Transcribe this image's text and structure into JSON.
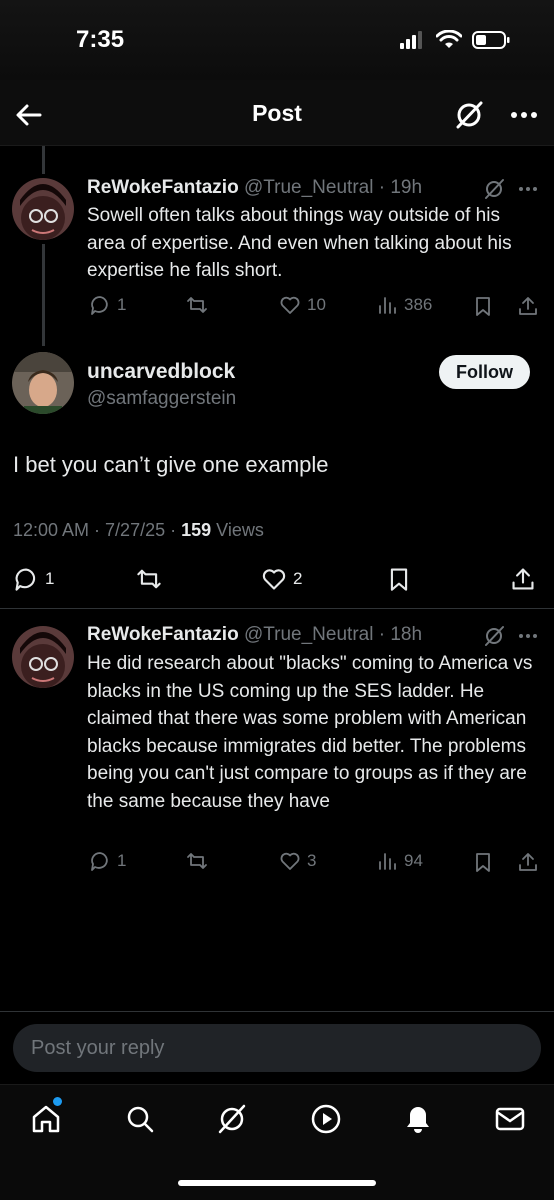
{
  "status": {
    "time": "7:35"
  },
  "header": {
    "title": "Post"
  },
  "reply1": {
    "name": "ReWokeFantazio",
    "handle_time": "@True_Neutral · 19h",
    "text": "Sowell often talks about things way outside of his area of expertise. And even when talking about his expertise he falls short.",
    "replies": "1",
    "likes": "10",
    "views": "386"
  },
  "main": {
    "name": "uncarvedblock",
    "handle": "@samfaggerstein",
    "follow_label": "Follow",
    "text": "I bet you can’t give one example",
    "timestamp": "12:00 AM · 7/27/25 · ",
    "views_count": "159",
    "views_label": " Views",
    "replies": "1",
    "likes": "2"
  },
  "reply2": {
    "name": "ReWokeFantazio",
    "handle_time": "@True_Neutral · 18h",
    "text": "He did research about \"blacks\" coming to America vs blacks in the US coming up the SES ladder. He claimed that there was some problem with American blacks because immigrates did better. The problems being you can't just compare to groups as if they are the same because they have",
    "replies": "1",
    "likes": "3",
    "views": "94"
  },
  "reply_box": {
    "placeholder": "Post your reply"
  },
  "colors": {
    "background": "#000000",
    "accent": "#1d9bf0",
    "muted": "#71767b",
    "text": "#e7e9ea"
  },
  "icons": [
    "back-arrow-icon",
    "grok-icon",
    "more-icon",
    "reply-icon",
    "retweet-icon",
    "like-icon",
    "views-icon",
    "bookmark-icon",
    "share-icon",
    "home-icon",
    "search-icon",
    "grok-icon",
    "video-icon",
    "notifications-icon",
    "messages-icon"
  ]
}
